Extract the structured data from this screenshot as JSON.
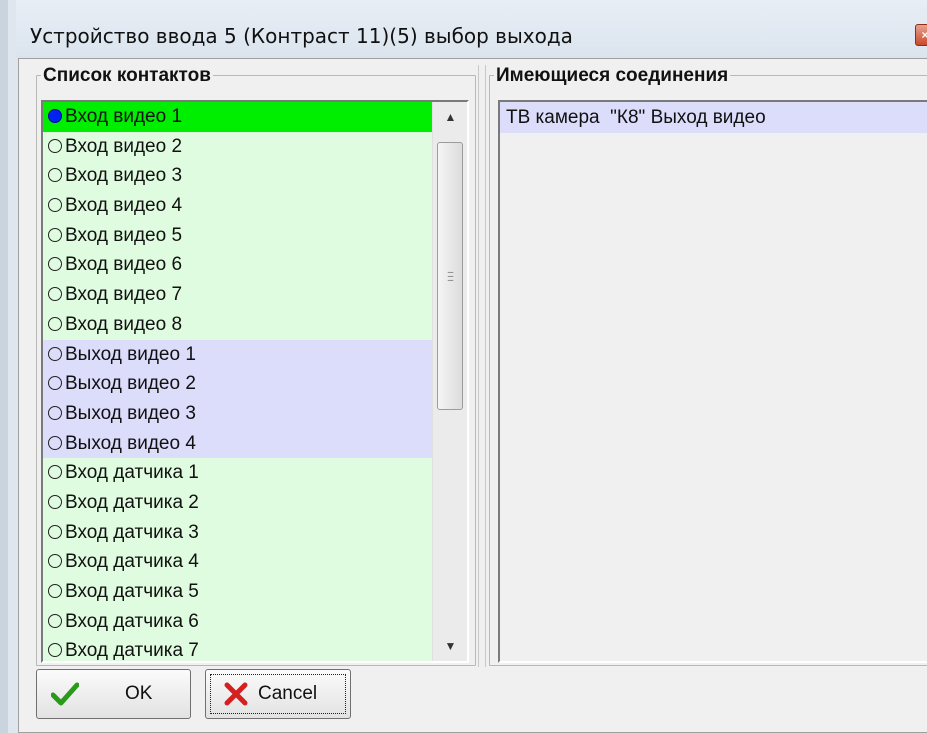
{
  "window": {
    "title": "Устройство ввода 5 (Контраст 11)(5) выбор выхода",
    "close_symbol": "×"
  },
  "contacts": {
    "title": "Список контактов",
    "items": [
      {
        "label": "Вход видео 1",
        "selected": true,
        "group": "video-in"
      },
      {
        "label": "Вход видео 2",
        "selected": false,
        "group": "video-in"
      },
      {
        "label": "Вход видео 3",
        "selected": false,
        "group": "video-in"
      },
      {
        "label": "Вход видео 4",
        "selected": false,
        "group": "video-in"
      },
      {
        "label": "Вход видео 5",
        "selected": false,
        "group": "video-in"
      },
      {
        "label": "Вход видео 6",
        "selected": false,
        "group": "video-in"
      },
      {
        "label": "Вход видео 7",
        "selected": false,
        "group": "video-in"
      },
      {
        "label": "Вход видео 8",
        "selected": false,
        "group": "video-in"
      },
      {
        "label": "Выход видео 1",
        "selected": false,
        "group": "video-out"
      },
      {
        "label": "Выход видео 2",
        "selected": false,
        "group": "video-out"
      },
      {
        "label": "Выход видео 3",
        "selected": false,
        "group": "video-out"
      },
      {
        "label": "Выход видео 4",
        "selected": false,
        "group": "video-out"
      },
      {
        "label": "Вход датчика 1",
        "selected": false,
        "group": "sensor-in"
      },
      {
        "label": "Вход датчика 2",
        "selected": false,
        "group": "sensor-in"
      },
      {
        "label": "Вход датчика 3",
        "selected": false,
        "group": "sensor-in"
      },
      {
        "label": "Вход датчика 4",
        "selected": false,
        "group": "sensor-in"
      },
      {
        "label": "Вход датчика 5",
        "selected": false,
        "group": "sensor-in"
      },
      {
        "label": "Вход датчика 6",
        "selected": false,
        "group": "sensor-in"
      },
      {
        "label": "Вход датчика 7",
        "selected": false,
        "group": "sensor-in"
      }
    ],
    "colors": {
      "selected": "#00ee00",
      "video-in": "#e0fce0",
      "video-out": "#dcdcfb",
      "sensor-in": "#e0fce0"
    }
  },
  "connections": {
    "title": "Имеющиеся соединения",
    "items": [
      "ТВ камера  \"К8\" Выход видео"
    ]
  },
  "buttons": {
    "ok_label": "OK",
    "cancel_label": "Cancel",
    "ok_icon": "checkmark-icon",
    "cancel_icon": "x-icon"
  }
}
